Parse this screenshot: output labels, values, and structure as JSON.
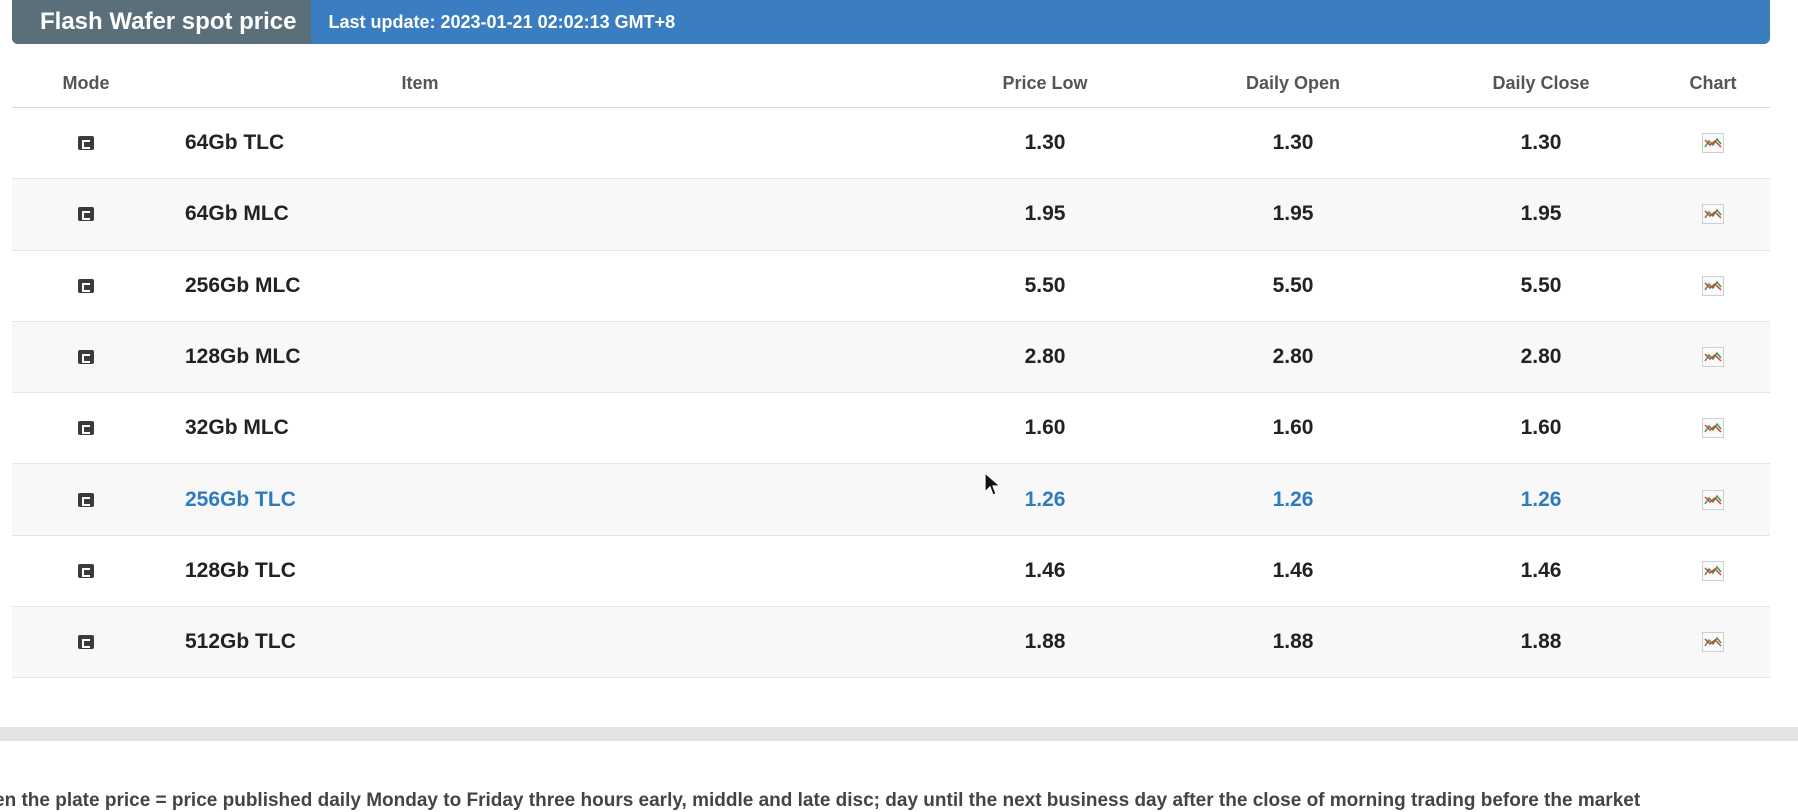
{
  "header": {
    "title": "Flash Wafer spot price",
    "last_update": "Last update: 2023-01-21 02:02:13 GMT+8"
  },
  "table": {
    "columns": {
      "mode": "Mode",
      "item": "Item",
      "price_low": "Price Low",
      "daily_open": "Daily Open",
      "daily_close": "Daily Close",
      "chart": "Chart"
    },
    "rows": [
      {
        "item": "64Gb TLC",
        "price_low": "1.30",
        "daily_open": "1.30",
        "daily_close": "1.30"
      },
      {
        "item": "64Gb MLC",
        "price_low": "1.95",
        "daily_open": "1.95",
        "daily_close": "1.95"
      },
      {
        "item": "256Gb MLC",
        "price_low": "5.50",
        "daily_open": "5.50",
        "daily_close": "5.50"
      },
      {
        "item": "128Gb MLC",
        "price_low": "2.80",
        "daily_open": "2.80",
        "daily_close": "2.80"
      },
      {
        "item": "32Gb MLC",
        "price_low": "1.60",
        "daily_open": "1.60",
        "daily_close": "1.60"
      },
      {
        "item": "256Gb TLC",
        "price_low": "1.26",
        "daily_open": "1.26",
        "daily_close": "1.26"
      },
      {
        "item": "128Gb TLC",
        "price_low": "1.46",
        "daily_open": "1.46",
        "daily_close": "1.46"
      },
      {
        "item": "512Gb TLC",
        "price_low": "1.88",
        "daily_open": "1.88",
        "daily_close": "1.88"
      }
    ],
    "highlight_color": "#2f7bbf"
  },
  "icons": {
    "mode": "mode-icon",
    "chart": "chart-icon"
  },
  "footer": {
    "note": "en the plate price = price published daily Monday to Friday three hours early, middle and late disc; day until the next business day after the close of morning trading before the market"
  }
}
